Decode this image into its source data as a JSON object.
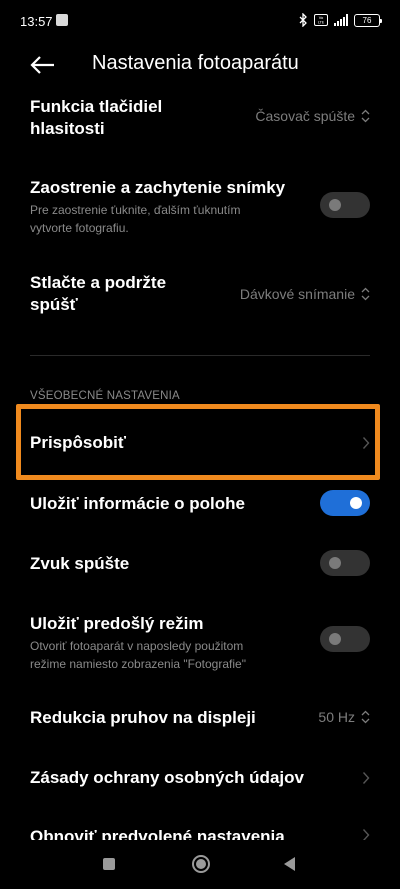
{
  "status_bar": {
    "time": "13:57",
    "volte": "Vo LTE",
    "battery": "76"
  },
  "header": {
    "title": "Nastavenia fotoaparátu"
  },
  "rows": [
    {
      "title_line1": "Funkcia tlačidiel",
      "title_line2": "hlasitosti",
      "value": "Časovač spúšte"
    },
    {
      "title": "Zaostrenie a zachytenie snímky",
      "sub_line1": "Pre zaostrenie ťuknite, ďalším ťuknutím",
      "sub_line2": "vytvorte fotografiu.",
      "toggle_on": false
    },
    {
      "title_line1": "Stlačte a podržte",
      "title_line2": "spúšť",
      "value": "Dávkové snímanie"
    },
    {
      "section": "VŠEOBECNÉ NASTAVENIA"
    },
    {
      "title": "Prispôsobiť"
    },
    {
      "title": "Uložiť informácie o polohe",
      "toggle_on": true
    },
    {
      "title": "Zvuk spúšte",
      "toggle_on": false
    },
    {
      "title": "Uložiť predošlý režim",
      "sub_line1": "Otvoriť fotoaparát v naposledy použitom",
      "sub_line2": "režime namiesto zobrazenia \"Fotografie\"",
      "toggle_on": false
    },
    {
      "title": "Redukcia pruhov na displeji",
      "value": "50 Hz"
    },
    {
      "title": "Zásady ochrany osobných údajov"
    },
    {
      "title": "Obnoviť predvolené nastavenia"
    }
  ]
}
